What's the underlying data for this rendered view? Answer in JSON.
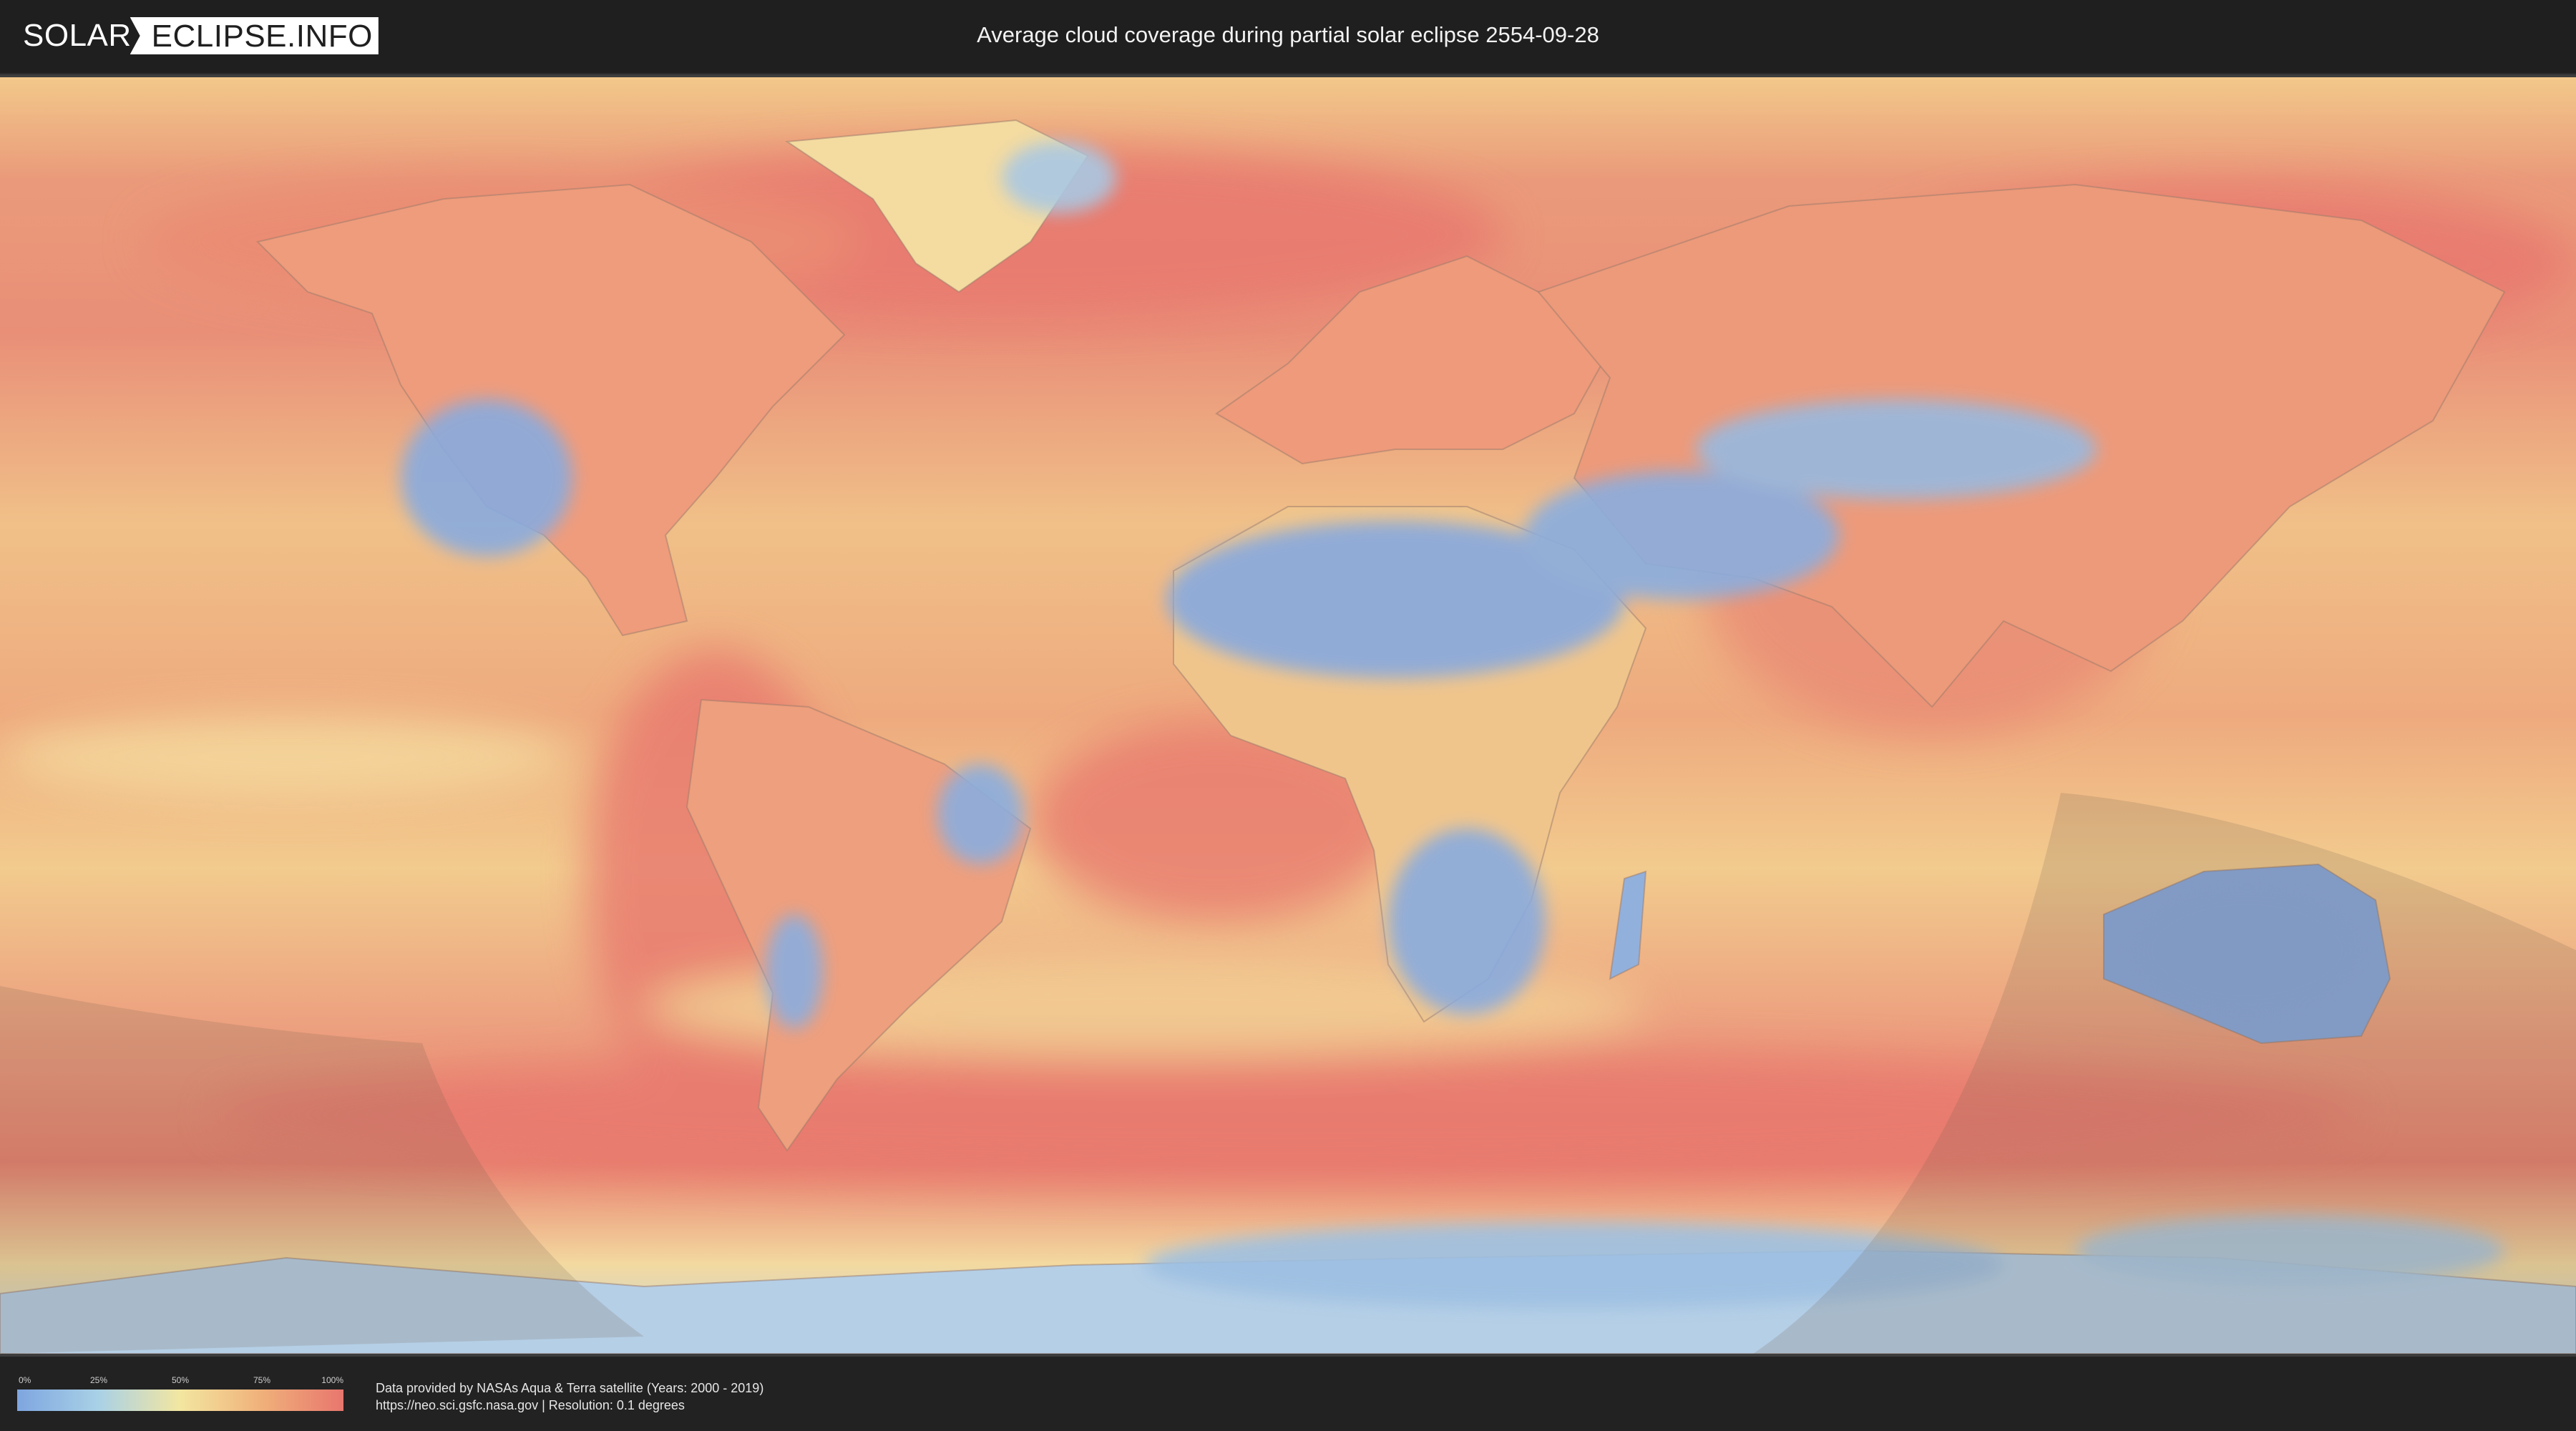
{
  "header": {
    "logo_left": "SOLAR",
    "logo_right": "ECLIPSE.INFO",
    "title": "Average cloud coverage during partial solar eclipse 2554-09-28"
  },
  "legend": {
    "ticks": [
      "0%",
      "25%",
      "50%",
      "75%",
      "100%"
    ],
    "colors": [
      "#7ea6e0",
      "#a9d1e6",
      "#f3e6a0",
      "#f0b07a",
      "#e8766e"
    ]
  },
  "credits": {
    "line1": "Data provided by NASAs Aqua & Terra satellite (Years: 2000 - 2019)",
    "line2": "https://neo.sci.gsfc.nasa.gov | Resolution: 0.1 degrees"
  },
  "map": {
    "colors": {
      "ocean_clear": "#f3d48c",
      "cloudy": "#e87a70",
      "clear": "#85a9df",
      "eclipse_shade": "#7a6a5a"
    }
  }
}
